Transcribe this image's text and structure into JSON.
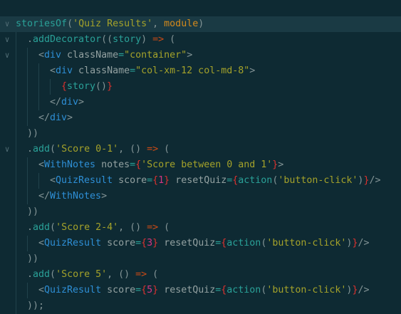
{
  "editor": {
    "colors": {
      "background": "#0e2a33",
      "current_line": "#1a3a44",
      "function": "#2aa198",
      "string": "#a4a22a",
      "keyword": "#d48a1c",
      "operator": "#cb4b16",
      "tag": "#2e8fd6",
      "attribute": "#93a1a1",
      "brace": "#dc322f",
      "number": "#d33682",
      "punctuation": "#839496"
    },
    "lines": [
      {
        "indent": 0,
        "fold": true,
        "current": true,
        "tokens": [
          [
            "storiesOf",
            "fn"
          ],
          [
            "(",
            "p"
          ],
          [
            "'Quiz Results'",
            "str"
          ],
          [
            ", ",
            "p"
          ],
          [
            "module",
            "kw"
          ],
          [
            ")",
            "p"
          ]
        ]
      },
      {
        "indent": 1,
        "fold": true,
        "tokens": [
          [
            ".",
            "p"
          ],
          [
            "addDecorator",
            "fn"
          ],
          [
            "((",
            "p"
          ],
          [
            "story",
            "fn"
          ],
          [
            ") ",
            "p"
          ],
          [
            "=>",
            "op"
          ],
          [
            " (",
            "p"
          ]
        ]
      },
      {
        "indent": 2,
        "fold": true,
        "tokens": [
          [
            "<",
            "p"
          ],
          [
            "div",
            "tag"
          ],
          [
            " className",
            "attr"
          ],
          [
            "=",
            "fn"
          ],
          [
            "\"container\"",
            "str"
          ],
          [
            ">",
            "p"
          ]
        ]
      },
      {
        "indent": 3,
        "tokens": [
          [
            "<",
            "p"
          ],
          [
            "div",
            "tag"
          ],
          [
            " className",
            "attr"
          ],
          [
            "=",
            "fn"
          ],
          [
            "\"col-xm-12 col-md-8\"",
            "str"
          ],
          [
            ">",
            "p"
          ]
        ]
      },
      {
        "indent": 4,
        "tokens": [
          [
            "{",
            "brace"
          ],
          [
            "story",
            "fn"
          ],
          [
            "()",
            "p"
          ],
          [
            "}",
            "brace"
          ]
        ]
      },
      {
        "indent": 3,
        "tokens": [
          [
            "</",
            "p"
          ],
          [
            "div",
            "tag"
          ],
          [
            ">",
            "p"
          ]
        ]
      },
      {
        "indent": 2,
        "tokens": [
          [
            "</",
            "p"
          ],
          [
            "div",
            "tag"
          ],
          [
            ">",
            "p"
          ]
        ]
      },
      {
        "indent": 1,
        "tokens": [
          [
            "))",
            "p"
          ]
        ]
      },
      {
        "indent": 1,
        "fold": true,
        "tokens": [
          [
            ".",
            "p"
          ],
          [
            "add",
            "fn"
          ],
          [
            "(",
            "p"
          ],
          [
            "'Score 0-1'",
            "str"
          ],
          [
            ", () ",
            "p"
          ],
          [
            "=>",
            "op"
          ],
          [
            " (",
            "p"
          ]
        ]
      },
      {
        "indent": 2,
        "tokens": [
          [
            "<",
            "p"
          ],
          [
            "WithNotes",
            "tag"
          ],
          [
            " notes",
            "attr"
          ],
          [
            "=",
            "fn"
          ],
          [
            "{",
            "brace"
          ],
          [
            "'Score between 0 and 1'",
            "str"
          ],
          [
            "}",
            "brace"
          ],
          [
            ">",
            "p"
          ]
        ]
      },
      {
        "indent": 3,
        "tokens": [
          [
            "<",
            "p"
          ],
          [
            "QuizResult",
            "tag"
          ],
          [
            " score",
            "attr"
          ],
          [
            "=",
            "fn"
          ],
          [
            "{",
            "brace"
          ],
          [
            "1",
            "num"
          ],
          [
            "}",
            "brace"
          ],
          [
            " resetQuiz",
            "attr"
          ],
          [
            "=",
            "fn"
          ],
          [
            "{",
            "brace"
          ],
          [
            "action",
            "fn"
          ],
          [
            "(",
            "p"
          ],
          [
            "'button-click'",
            "str"
          ],
          [
            ")",
            "p"
          ],
          [
            "}",
            "brace"
          ],
          [
            "/>",
            "p"
          ]
        ]
      },
      {
        "indent": 2,
        "tokens": [
          [
            "</",
            "p"
          ],
          [
            "WithNotes",
            "tag"
          ],
          [
            ">",
            "p"
          ]
        ]
      },
      {
        "indent": 1,
        "tokens": [
          [
            "))",
            "p"
          ]
        ]
      },
      {
        "indent": 1,
        "tokens": [
          [
            ".",
            "p"
          ],
          [
            "add",
            "fn"
          ],
          [
            "(",
            "p"
          ],
          [
            "'Score 2-4'",
            "str"
          ],
          [
            ", () ",
            "p"
          ],
          [
            "=>",
            "op"
          ],
          [
            " (",
            "p"
          ]
        ]
      },
      {
        "indent": 2,
        "tokens": [
          [
            "<",
            "p"
          ],
          [
            "QuizResult",
            "tag"
          ],
          [
            " score",
            "attr"
          ],
          [
            "=",
            "fn"
          ],
          [
            "{",
            "brace"
          ],
          [
            "3",
            "num"
          ],
          [
            "}",
            "brace"
          ],
          [
            " resetQuiz",
            "attr"
          ],
          [
            "=",
            "fn"
          ],
          [
            "{",
            "brace"
          ],
          [
            "action",
            "fn"
          ],
          [
            "(",
            "p"
          ],
          [
            "'button-click'",
            "str"
          ],
          [
            ")",
            "p"
          ],
          [
            "}",
            "brace"
          ],
          [
            "/>",
            "p"
          ]
        ]
      },
      {
        "indent": 1,
        "tokens": [
          [
            "))",
            "p"
          ]
        ]
      },
      {
        "indent": 1,
        "tokens": [
          [
            ".",
            "p"
          ],
          [
            "add",
            "fn"
          ],
          [
            "(",
            "p"
          ],
          [
            "'Score 5'",
            "str"
          ],
          [
            ", () ",
            "p"
          ],
          [
            "=>",
            "op"
          ],
          [
            " (",
            "p"
          ]
        ]
      },
      {
        "indent": 2,
        "tokens": [
          [
            "<",
            "p"
          ],
          [
            "QuizResult",
            "tag"
          ],
          [
            " score",
            "attr"
          ],
          [
            "=",
            "fn"
          ],
          [
            "{",
            "brace"
          ],
          [
            "5",
            "num"
          ],
          [
            "}",
            "brace"
          ],
          [
            " resetQuiz",
            "attr"
          ],
          [
            "=",
            "fn"
          ],
          [
            "{",
            "brace"
          ],
          [
            "action",
            "fn"
          ],
          [
            "(",
            "p"
          ],
          [
            "'button-click'",
            "str"
          ],
          [
            ")",
            "p"
          ],
          [
            "}",
            "brace"
          ],
          [
            "/>",
            "p"
          ]
        ]
      },
      {
        "indent": 1,
        "tokens": [
          [
            "));",
            "p"
          ]
        ]
      }
    ]
  }
}
